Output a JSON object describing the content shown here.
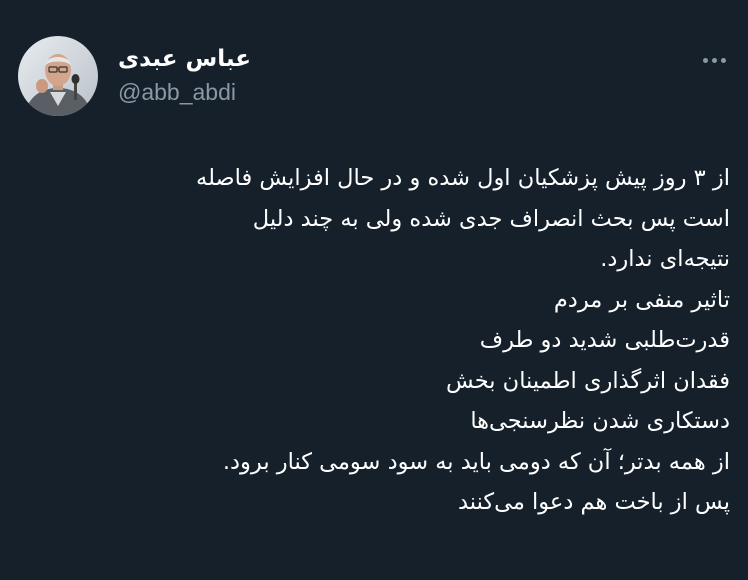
{
  "author": {
    "display_name": "عباس عبدی",
    "handle": "@abb_abdi"
  },
  "menu": {
    "icon": "more-horizontal-icon"
  },
  "tweet": {
    "lines": [
      "از ۳ روز پیش پزشکیان اول شده و در حال افزایش فاصله",
      "است پس بحث انصراف جدی شده ولی به چند دلیل",
      "نتیجه‌ای ندارد.",
      "تاثیر منفی بر مردم",
      "قدرت‌طلبی شدید دو طرف",
      "فقدان اثرگذاری اطمینان بخش",
      "دستکاری شدن نظرسنجی‌ها",
      "از همه بدتر؛ آن که دومی باید به سود سومی کنار برود.",
      "پس از باخت هم دعوا می‌کنند"
    ]
  },
  "colors": {
    "background": "#15202b",
    "text_primary": "#ffffff",
    "text_secondary": "#8b98a5"
  }
}
